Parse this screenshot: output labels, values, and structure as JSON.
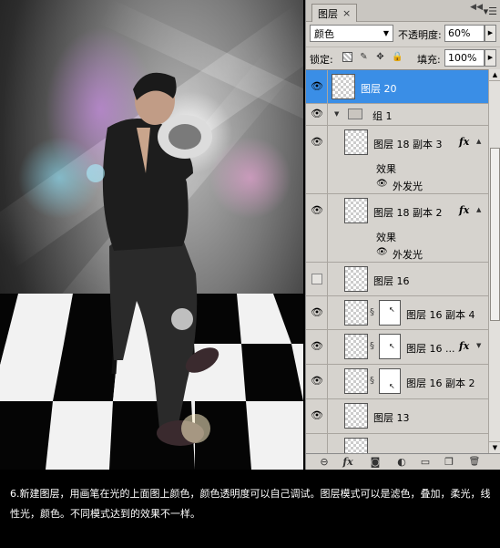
{
  "panel": {
    "tab_label": "图层",
    "tab_close": "×",
    "collapse_glyph": "◀◀",
    "menu_glyph": "▾☰",
    "blend_mode": "颜色",
    "opacity_label": "不透明度:",
    "opacity_value": "60%",
    "lock_label": "锁定:",
    "fill_label": "填充:",
    "fill_value": "100%",
    "layers": [
      {
        "name": "图层 20",
        "visible": true,
        "selected": true
      },
      {
        "name": "组 1",
        "visible": true,
        "type": "group"
      },
      {
        "name": "图层 18 副本 3",
        "visible": true,
        "fx": "fx"
      },
      {
        "name": "效果",
        "type": "effects-header"
      },
      {
        "name": "外发光",
        "type": "effect"
      },
      {
        "name": "图层 18 副本 2",
        "visible": true,
        "fx": "fx"
      },
      {
        "name": "效果",
        "type": "effects-header"
      },
      {
        "name": "外发光",
        "type": "effect"
      },
      {
        "name": "图层 16",
        "visible": false
      },
      {
        "name": "图层 16 副本 4",
        "visible": true,
        "mask": true
      },
      {
        "name": "图层 16 ...",
        "visible": true,
        "mask": true,
        "fx": "fx"
      },
      {
        "name": "图层 16 副本 2",
        "visible": true,
        "mask": true
      },
      {
        "name": "图层 13",
        "visible": true
      }
    ],
    "bottom_icons": [
      "link-icon",
      "fx-icon",
      "mask-icon",
      "adjustment-icon",
      "folder-icon",
      "new-layer-icon",
      "trash-icon"
    ],
    "bottom_glyphs": {
      "link": "⊖",
      "fx": "fx",
      "mask": "◙",
      "adjust": "◐",
      "folder": "▭",
      "new": "❐",
      "trash": "🗑"
    }
  },
  "caption": "6.新建图层，用画笔在光的上面图上颜色，颜色透明度可以自己调试。图层模式可以是滤色，叠加，柔光，线性光，颜色。不同模式达到的效果不一样。",
  "colors": {
    "panel_bg": "#d6d3ce",
    "selection": "#3a8ee6",
    "caption_bg": "#000000"
  }
}
